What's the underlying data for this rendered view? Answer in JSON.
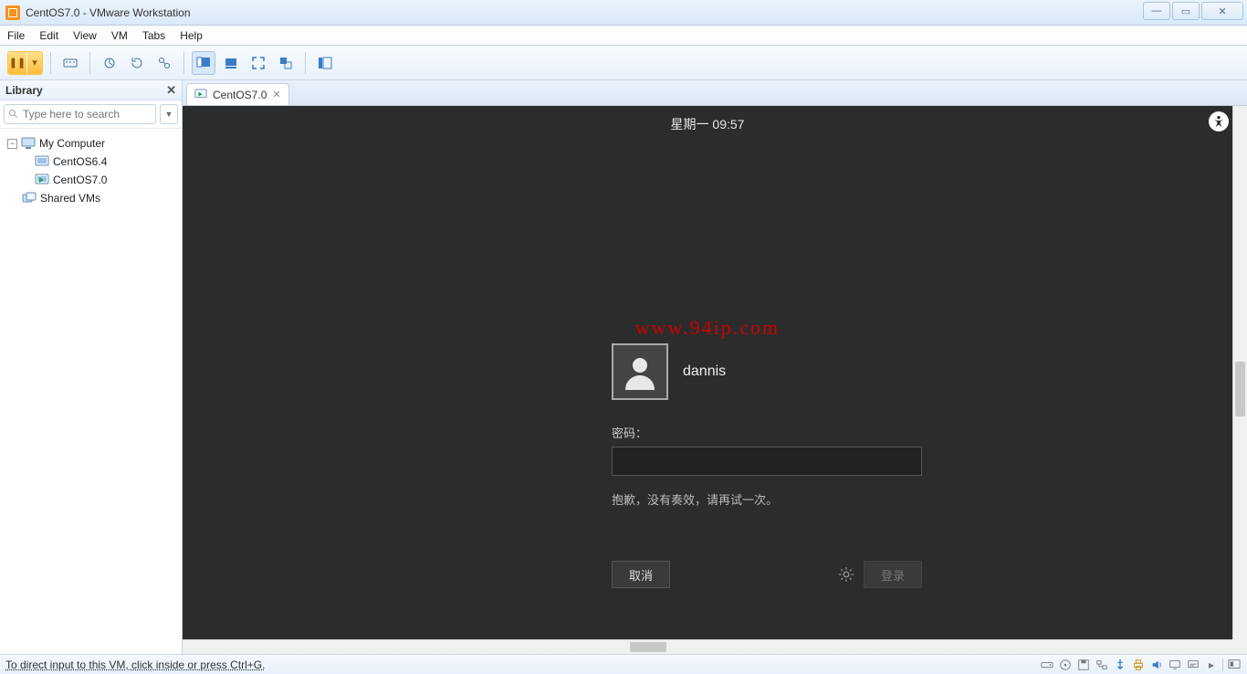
{
  "window": {
    "title": "CentOS7.0 - VMware Workstation"
  },
  "menu": {
    "items": [
      "File",
      "Edit",
      "View",
      "VM",
      "Tabs",
      "Help"
    ]
  },
  "library": {
    "title": "Library",
    "search_placeholder": "Type here to search",
    "nodes": {
      "root": "My Computer",
      "vm1": "CentOS6.4",
      "vm2": "CentOS7.0",
      "shared": "Shared VMs"
    }
  },
  "tab": {
    "label": "CentOS7.0"
  },
  "guest": {
    "clock": "星期一 09:57",
    "watermark": "www.94ip.com",
    "username": "dannis",
    "password_label": "密码：",
    "password_value": "",
    "error": "抱歉，没有奏效，请再试一次。",
    "cancel": "取消",
    "login": "登录"
  },
  "statusbar": {
    "hint": "To direct input to this VM, click inside or press Ctrl+G."
  }
}
